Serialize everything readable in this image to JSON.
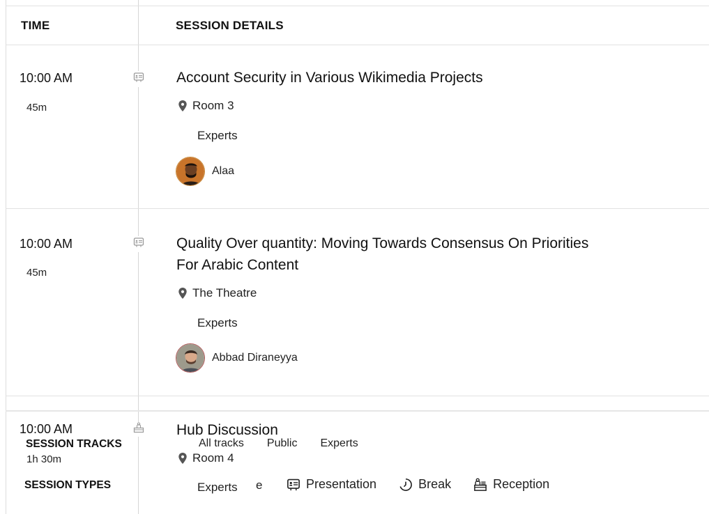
{
  "headers": {
    "time": "TIME",
    "details": "SESSION DETAILS"
  },
  "sessions": [
    {
      "time": "10:00 AM",
      "duration": "45m",
      "type_icon": "presentation-icon",
      "title_line1": "Account Security in Various Wikimedia Projects",
      "title_line2": "",
      "location": "Room 3",
      "track": "Experts",
      "speaker": "Alaa"
    },
    {
      "time": "10:00 AM",
      "duration": "45m",
      "type_icon": "presentation-icon",
      "title_line1": "Quality Over quantity: Moving Towards Consensus On Priorities",
      "title_line2": "For Arabic Content",
      "location": "The Theatre",
      "track": "Experts",
      "speaker": "Abbad Diraneyya"
    },
    {
      "time": "10:00 AM",
      "duration": "1h 30m",
      "type_icon": "reception-icon",
      "title_line1": "Hub Discussion",
      "location": "Room 4",
      "track": "Experts"
    }
  ],
  "filters": {
    "tracks_label": "SESSION TRACKS",
    "tracks": [
      "All tracks",
      "Public",
      "Experts"
    ],
    "types_label": "SESSION TYPES",
    "types_partial": "e",
    "types": [
      {
        "label": "Presentation",
        "icon": "presentation-icon"
      },
      {
        "label": "Break",
        "icon": "clock-icon"
      },
      {
        "label": "Reception",
        "icon": "reception-icon"
      }
    ]
  },
  "colors": {
    "accent_icon": "#9a9a9a",
    "divider": "#e1e1e1",
    "avatar_border": "#c98a3c"
  }
}
